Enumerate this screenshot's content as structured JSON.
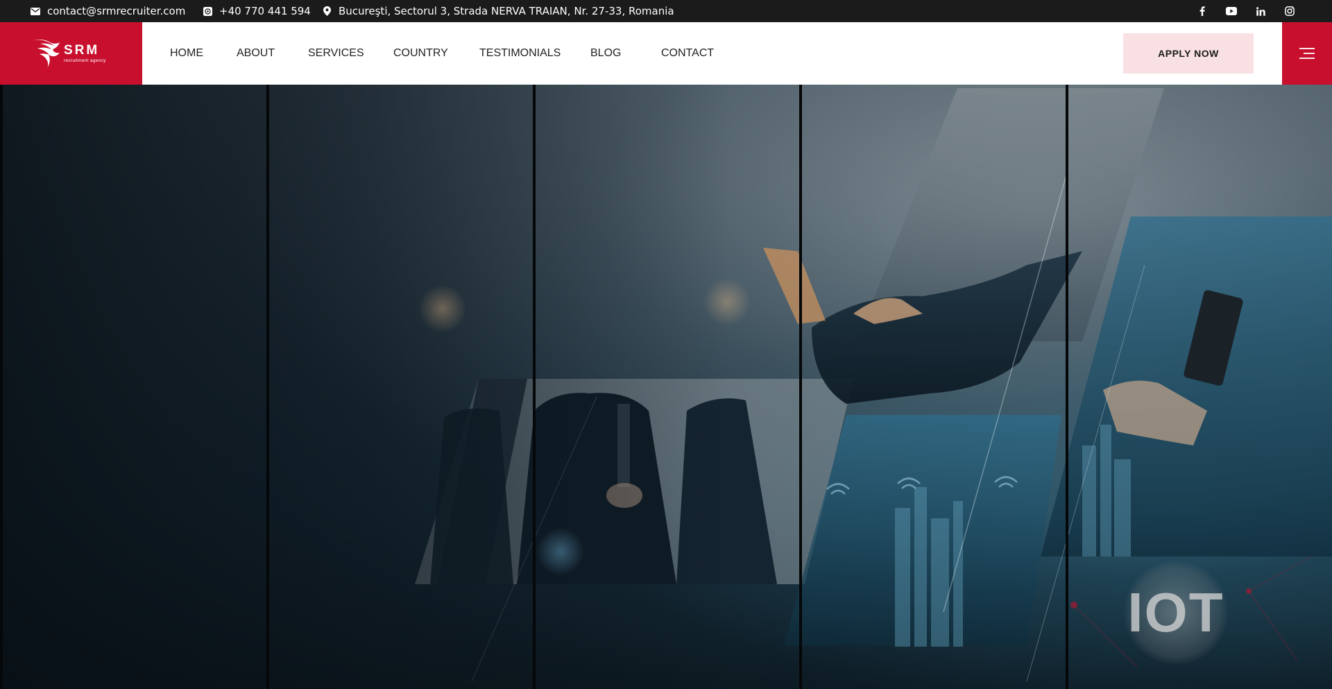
{
  "topbar": {
    "email": "contact@srmrecruiter.com",
    "phone": "+40 770 441 594",
    "address": "Bucureşti, Sectorul 3, Strada NERVA TRAIAN, Nr. 27-33, Romania",
    "icons": {
      "email": "envelope-icon",
      "phone": "whatsapp-icon",
      "address": "map-pin-icon"
    },
    "social": [
      "facebook-icon",
      "youtube-icon",
      "linkedin-icon",
      "instagram-icon"
    ]
  },
  "header": {
    "logo": {
      "name": "SRM",
      "tagline": "recruitment agency",
      "background": "#c8102e"
    },
    "nav": [
      {
        "label": "HOME"
      },
      {
        "label": "ABOUT"
      },
      {
        "label": "SERVICES"
      },
      {
        "label": "COUNTRY"
      },
      {
        "label": "TESTIMONIALS"
      },
      {
        "label": "BLOG"
      },
      {
        "label": "CONTACT"
      }
    ],
    "apply_label": "APPLY NOW",
    "menu_icon": "hamburger-menu-icon"
  },
  "hero": {
    "badge_text": "IOT",
    "accent": "#c8102e",
    "overlay": "#0f1d26"
  }
}
